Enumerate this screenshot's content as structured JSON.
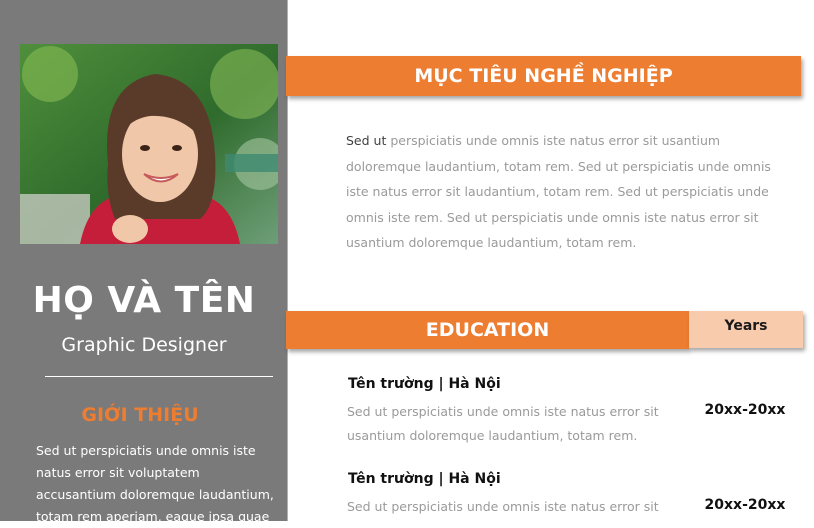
{
  "profile": {
    "name": "HỌ VÀ TÊN",
    "job_title": "Graphic Designer"
  },
  "intro": {
    "heading": "GIỚI THIỆU",
    "text": "Sed ut perspiciatis unde omnis iste natus error sit voluptatem accusantium doloremque laudantium, totam rem aperiam, eaque ipsa quae"
  },
  "objective": {
    "heading": "MỤC TIÊU NGHỀ NGHIỆP",
    "lead": "Sed ut",
    "text": " perspiciatis unde omnis iste natus error sit usantium doloremque laudantium, totam rem. Sed ut perspiciatis unde omnis iste natus error sit laudantium, totam rem. Sed ut perspiciatis unde omnis iste rem. Sed ut perspiciatis unde omnis iste natus error sit usantium doloremque laudantium, totam rem."
  },
  "education": {
    "heading": "EDUCATION",
    "years_heading": "Years",
    "entries": [
      {
        "school": "Tên trường | Hà Nội",
        "desc": "Sed ut perspiciatis unde omnis iste natus error sit usantium doloremque laudantium, totam rem.",
        "years": "20xx-20xx"
      },
      {
        "school": "Tên trường | Hà Nội",
        "desc": "Sed ut perspiciatis unde omnis iste natus error sit",
        "years": "20xx-20xx"
      }
    ]
  },
  "colors": {
    "accent": "#ed7d31",
    "accent_light": "#f8cbad",
    "sidebar": "#7a7a7a"
  }
}
